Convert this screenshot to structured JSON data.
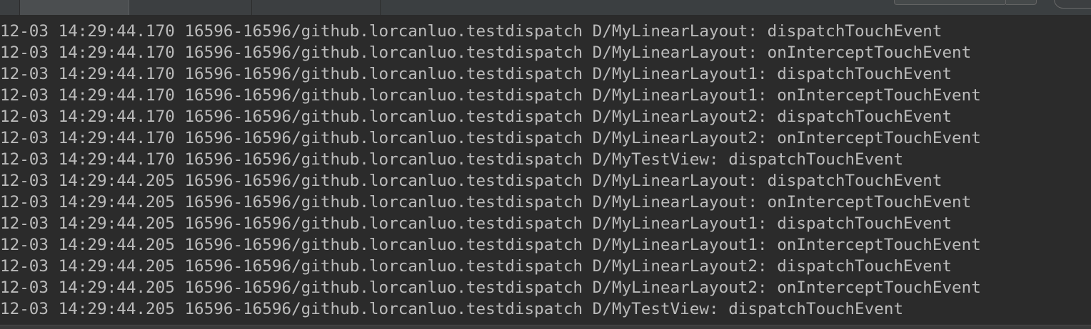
{
  "logcat": {
    "lines": [
      "12-03 14:29:44.170 16596-16596/github.lorcanluo.testdispatch D/MyLinearLayout: dispatchTouchEvent",
      "12-03 14:29:44.170 16596-16596/github.lorcanluo.testdispatch D/MyLinearLayout: onInterceptTouchEvent",
      "12-03 14:29:44.170 16596-16596/github.lorcanluo.testdispatch D/MyLinearLayout1: dispatchTouchEvent",
      "12-03 14:29:44.170 16596-16596/github.lorcanluo.testdispatch D/MyLinearLayout1: onInterceptTouchEvent",
      "12-03 14:29:44.170 16596-16596/github.lorcanluo.testdispatch D/MyLinearLayout2: dispatchTouchEvent",
      "12-03 14:29:44.170 16596-16596/github.lorcanluo.testdispatch D/MyLinearLayout2: onInterceptTouchEvent",
      "12-03 14:29:44.170 16596-16596/github.lorcanluo.testdispatch D/MyTestView: dispatchTouchEvent",
      "12-03 14:29:44.205 16596-16596/github.lorcanluo.testdispatch D/MyLinearLayout: dispatchTouchEvent",
      "12-03 14:29:44.205 16596-16596/github.lorcanluo.testdispatch D/MyLinearLayout: onInterceptTouchEvent",
      "12-03 14:29:44.205 16596-16596/github.lorcanluo.testdispatch D/MyLinearLayout1: dispatchTouchEvent",
      "12-03 14:29:44.205 16596-16596/github.lorcanluo.testdispatch D/MyLinearLayout1: onInterceptTouchEvent",
      "12-03 14:29:44.205 16596-16596/github.lorcanluo.testdispatch D/MyLinearLayout2: dispatchTouchEvent",
      "12-03 14:29:44.205 16596-16596/github.lorcanluo.testdispatch D/MyLinearLayout2: onInterceptTouchEvent",
      "12-03 14:29:44.205 16596-16596/github.lorcanluo.testdispatch D/MyTestView: dispatchTouchEvent"
    ]
  },
  "colors": {
    "background": "#2b2b2b",
    "text": "#bbbbbb",
    "tabbar": "#3c3f41"
  }
}
